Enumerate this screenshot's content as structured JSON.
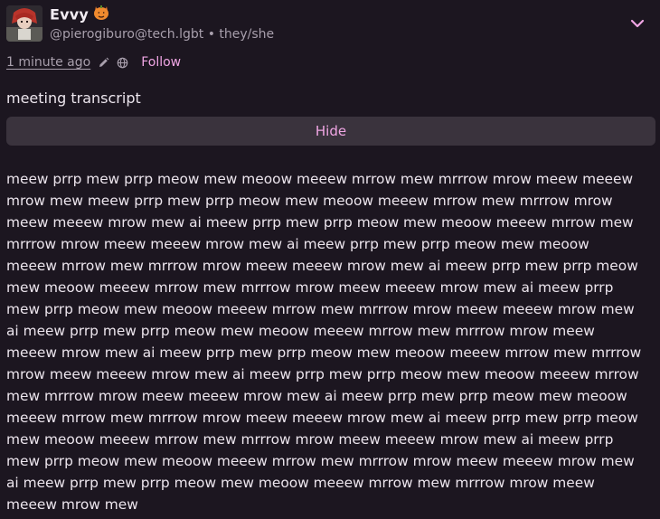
{
  "author": {
    "display_name": "Evvy",
    "handle": "@pierogiburo@tech.lgbt",
    "separator": "•",
    "pronouns": "they/she"
  },
  "meta": {
    "timestamp": "1 minute ago",
    "follow_label": "Follow",
    "icons": [
      "pencil-icon",
      "globe-icon"
    ]
  },
  "content_warning": "meeting transcript",
  "hide_button_label": "Hide",
  "body_lines": [
    "meew prrp mew prrp meow mew meoow meeew mrrow mew mrrrow mrow meew meeew",
    "mrow mew meew prrp mew prrp meow mew meoow meeew mrrow mew mrrrow mrow",
    "meew meeew mrow mew ai meew prrp mew prrp meow mew meoow meeew mrrow mew",
    "mrrrow mrow meew meeew mrow mew ai meew prrp mew prrp meow mew meoow",
    "meeew mrrow mew mrrrow mrow meew meeew mrow mew ai meew prrp mew prrp meow",
    "mew meoow meeew mrrow mew mrrrow mrow meew meeew mrow mew ai meew prrp",
    "mew prrp meow mew meoow meeew mrrow mew mrrrow mrow meew meeew mrow mew",
    "ai meew prrp mew prrp meow mew meoow meeew mrrow mew mrrrow mrow meew",
    "meeew mrow mew ai meew prrp mew prrp meow mew meoow meeew mrrow mew mrrrow",
    "mrow meew meeew mrow mew ai meew prrp mew prrp meow mew meoow meeew mrrow",
    "mew mrrrow mrow meew meeew mrow mew ai meew prrp mew prrp meow mew meoow",
    "meeew mrrow mew mrrrow mrow meew meeew mrow mew ai meew prrp mew prrp meow",
    "mew meoow meeew mrrow mew mrrrow mrow meew meeew mrow mew ai meew prrp",
    "mew prrp meow mew meoow meeew mrrow mew mrrrow mrow meew meeew mrow mew",
    "ai meew prrp mew prrp meow mew meoow meeew mrrow mew mrrrow mrow meew",
    "meeew mrow mew"
  ],
  "colors": {
    "background": "#1c1620",
    "accent": "#f0a6e4",
    "muted_text": "#a89fac",
    "button_bg": "#3a333d"
  }
}
